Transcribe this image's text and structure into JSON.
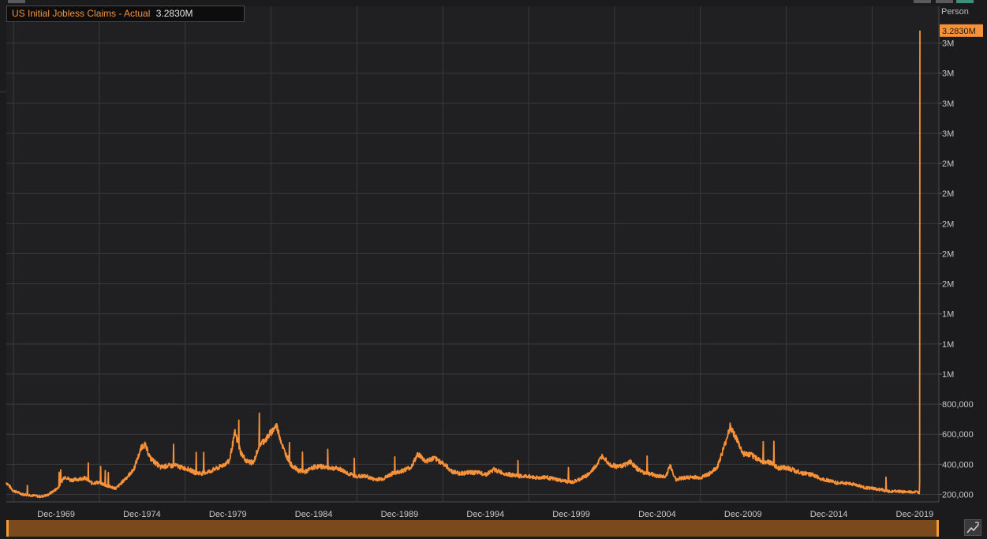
{
  "legend": {
    "series_name": "US Initial Jobless Claims - Actual",
    "current_value": "3.2830M"
  },
  "controls": {
    "chart_type_icon": "chart-type-icon",
    "navigator": "range-navigator"
  },
  "colors": {
    "background": "#1b1b1d",
    "plot_background": "#202022",
    "line": "#f7923a",
    "grid": "#3a3a3c",
    "axis_text": "#c8c8c8"
  },
  "chart_data": {
    "type": "line",
    "title": "US Initial Jobless Claims - Actual",
    "ylabel": "Person",
    "xlabel": "",
    "ylim": [
      150000,
      3350000
    ],
    "grid": true,
    "legend_position": "top-left",
    "x_ticks": [
      "Dec-1969",
      "Dec-1974",
      "Dec-1979",
      "Dec-1984",
      "Dec-1989",
      "Dec-1994",
      "Dec-1999",
      "Dec-2004",
      "Dec-2009",
      "Dec-2014",
      "Dec-2019"
    ],
    "y_ticks": [
      {
        "value": 200000,
        "label": "200,000"
      },
      {
        "value": 400000,
        "label": "400,000"
      },
      {
        "value": 600000,
        "label": "600,000"
      },
      {
        "value": 800000,
        "label": "800,000"
      },
      {
        "value": 1000000,
        "label": "1M"
      },
      {
        "value": 1200000,
        "label": "1M"
      },
      {
        "value": 1400000,
        "label": "1M"
      },
      {
        "value": 1600000,
        "label": "2M"
      },
      {
        "value": 1800000,
        "label": "2M"
      },
      {
        "value": 2000000,
        "label": "2M"
      },
      {
        "value": 2200000,
        "label": "2M"
      },
      {
        "value": 2400000,
        "label": "2M"
      },
      {
        "value": 2600000,
        "label": "3M"
      },
      {
        "value": 2800000,
        "label": "3M"
      },
      {
        "value": 3000000,
        "label": "3M"
      },
      {
        "value": 3200000,
        "label": "3M"
      }
    ],
    "last_value_label": "3.2830M",
    "last_value": 3283000,
    "x_range": [
      "1967-01-07",
      "2020-03-21"
    ],
    "series": [
      {
        "name": "US Initial Jobless Claims - Actual",
        "points": [
          [
            "1967-01-07",
            280000
          ],
          [
            "1967-06-01",
            225000
          ],
          [
            "1968-01-01",
            200000
          ],
          [
            "1968-06-01",
            195000
          ],
          [
            "1969-01-01",
            185000
          ],
          [
            "1969-06-01",
            195000
          ],
          [
            "1970-01-01",
            240000
          ],
          [
            "1970-06-01",
            320000
          ],
          [
            "1970-10-01",
            295000
          ],
          [
            "1971-03-01",
            300000
          ],
          [
            "1971-08-01",
            310000
          ],
          [
            "1972-01-01",
            275000
          ],
          [
            "1972-06-01",
            280000
          ],
          [
            "1972-12-01",
            255000
          ],
          [
            "1973-06-01",
            240000
          ],
          [
            "1973-11-01",
            290000
          ],
          [
            "1974-06-01",
            360000
          ],
          [
            "1974-12-01",
            520000
          ],
          [
            "1975-02-01",
            530000
          ],
          [
            "1975-06-01",
            440000
          ],
          [
            "1976-01-01",
            380000
          ],
          [
            "1976-06-01",
            390000
          ],
          [
            "1977-01-01",
            390000
          ],
          [
            "1977-03-01",
            380000
          ],
          [
            "1977-08-01",
            370000
          ],
          [
            "1978-01-01",
            345000
          ],
          [
            "1978-06-01",
            340000
          ],
          [
            "1978-12-01",
            355000
          ],
          [
            "1979-06-01",
            380000
          ],
          [
            "1980-01-01",
            420000
          ],
          [
            "1980-05-01",
            610000
          ],
          [
            "1980-09-01",
            480000
          ],
          [
            "1981-01-01",
            420000
          ],
          [
            "1981-06-01",
            410000
          ],
          [
            "1981-10-01",
            530000
          ],
          [
            "1982-03-01",
            570000
          ],
          [
            "1982-10-01",
            660000
          ],
          [
            "1983-03-01",
            500000
          ],
          [
            "1983-08-01",
            400000
          ],
          [
            "1984-01-01",
            360000
          ],
          [
            "1984-06-01",
            350000
          ],
          [
            "1985-01-01",
            385000
          ],
          [
            "1985-06-01",
            385000
          ],
          [
            "1986-01-01",
            375000
          ],
          [
            "1986-06-01",
            370000
          ],
          [
            "1987-01-01",
            335000
          ],
          [
            "1987-06-01",
            320000
          ],
          [
            "1988-01-01",
            320000
          ],
          [
            "1988-06-01",
            300000
          ],
          [
            "1989-01-01",
            305000
          ],
          [
            "1989-06-01",
            335000
          ],
          [
            "1990-01-01",
            355000
          ],
          [
            "1990-08-01",
            380000
          ],
          [
            "1991-01-01",
            470000
          ],
          [
            "1991-06-01",
            420000
          ],
          [
            "1991-12-01",
            440000
          ],
          [
            "1992-06-01",
            410000
          ],
          [
            "1993-01-01",
            350000
          ],
          [
            "1993-06-01",
            340000
          ],
          [
            "1994-01-01",
            345000
          ],
          [
            "1994-06-01",
            345000
          ],
          [
            "1995-01-01",
            335000
          ],
          [
            "1995-06-01",
            365000
          ],
          [
            "1996-01-01",
            340000
          ],
          [
            "1996-06-01",
            330000
          ],
          [
            "1997-01-01",
            320000
          ],
          [
            "1997-06-01",
            320000
          ],
          [
            "1998-01-01",
            310000
          ],
          [
            "1998-06-01",
            315000
          ],
          [
            "1999-01-01",
            300000
          ],
          [
            "1999-06-01",
            290000
          ],
          [
            "2000-01-01",
            280000
          ],
          [
            "2000-06-01",
            300000
          ],
          [
            "2001-01-01",
            340000
          ],
          [
            "2001-06-01",
            400000
          ],
          [
            "2001-10-01",
            460000
          ],
          [
            "2002-03-01",
            400000
          ],
          [
            "2002-08-01",
            385000
          ],
          [
            "2003-01-01",
            395000
          ],
          [
            "2003-05-01",
            420000
          ],
          [
            "2003-10-01",
            370000
          ],
          [
            "2004-03-01",
            345000
          ],
          [
            "2004-08-01",
            335000
          ],
          [
            "2005-01-01",
            320000
          ],
          [
            "2005-06-01",
            320000
          ],
          [
            "2005-09-01",
            390000
          ],
          [
            "2006-01-01",
            300000
          ],
          [
            "2006-06-01",
            310000
          ],
          [
            "2007-01-01",
            315000
          ],
          [
            "2007-06-01",
            310000
          ],
          [
            "2008-01-01",
            340000
          ],
          [
            "2008-06-01",
            380000
          ],
          [
            "2008-11-01",
            520000
          ],
          [
            "2009-03-01",
            650000
          ],
          [
            "2009-06-01",
            600000
          ],
          [
            "2009-12-01",
            470000
          ],
          [
            "2010-06-01",
            460000
          ],
          [
            "2011-01-01",
            420000
          ],
          [
            "2011-06-01",
            415000
          ],
          [
            "2012-01-01",
            375000
          ],
          [
            "2012-06-01",
            380000
          ],
          [
            "2013-01-01",
            355000
          ],
          [
            "2013-06-01",
            340000
          ],
          [
            "2014-01-01",
            330000
          ],
          [
            "2014-06-01",
            305000
          ],
          [
            "2015-01-01",
            290000
          ],
          [
            "2015-06-01",
            275000
          ],
          [
            "2016-01-01",
            275000
          ],
          [
            "2016-06-01",
            265000
          ],
          [
            "2017-01-01",
            245000
          ],
          [
            "2017-06-01",
            240000
          ],
          [
            "2018-01-01",
            230000
          ],
          [
            "2018-06-01",
            220000
          ],
          [
            "2019-01-01",
            220000
          ],
          [
            "2019-06-01",
            215000
          ],
          [
            "2020-01-01",
            215000
          ],
          [
            "2020-03-07",
            211000
          ],
          [
            "2020-03-14",
            282000
          ],
          [
            "2020-03-21",
            3283000
          ]
        ]
      }
    ]
  }
}
